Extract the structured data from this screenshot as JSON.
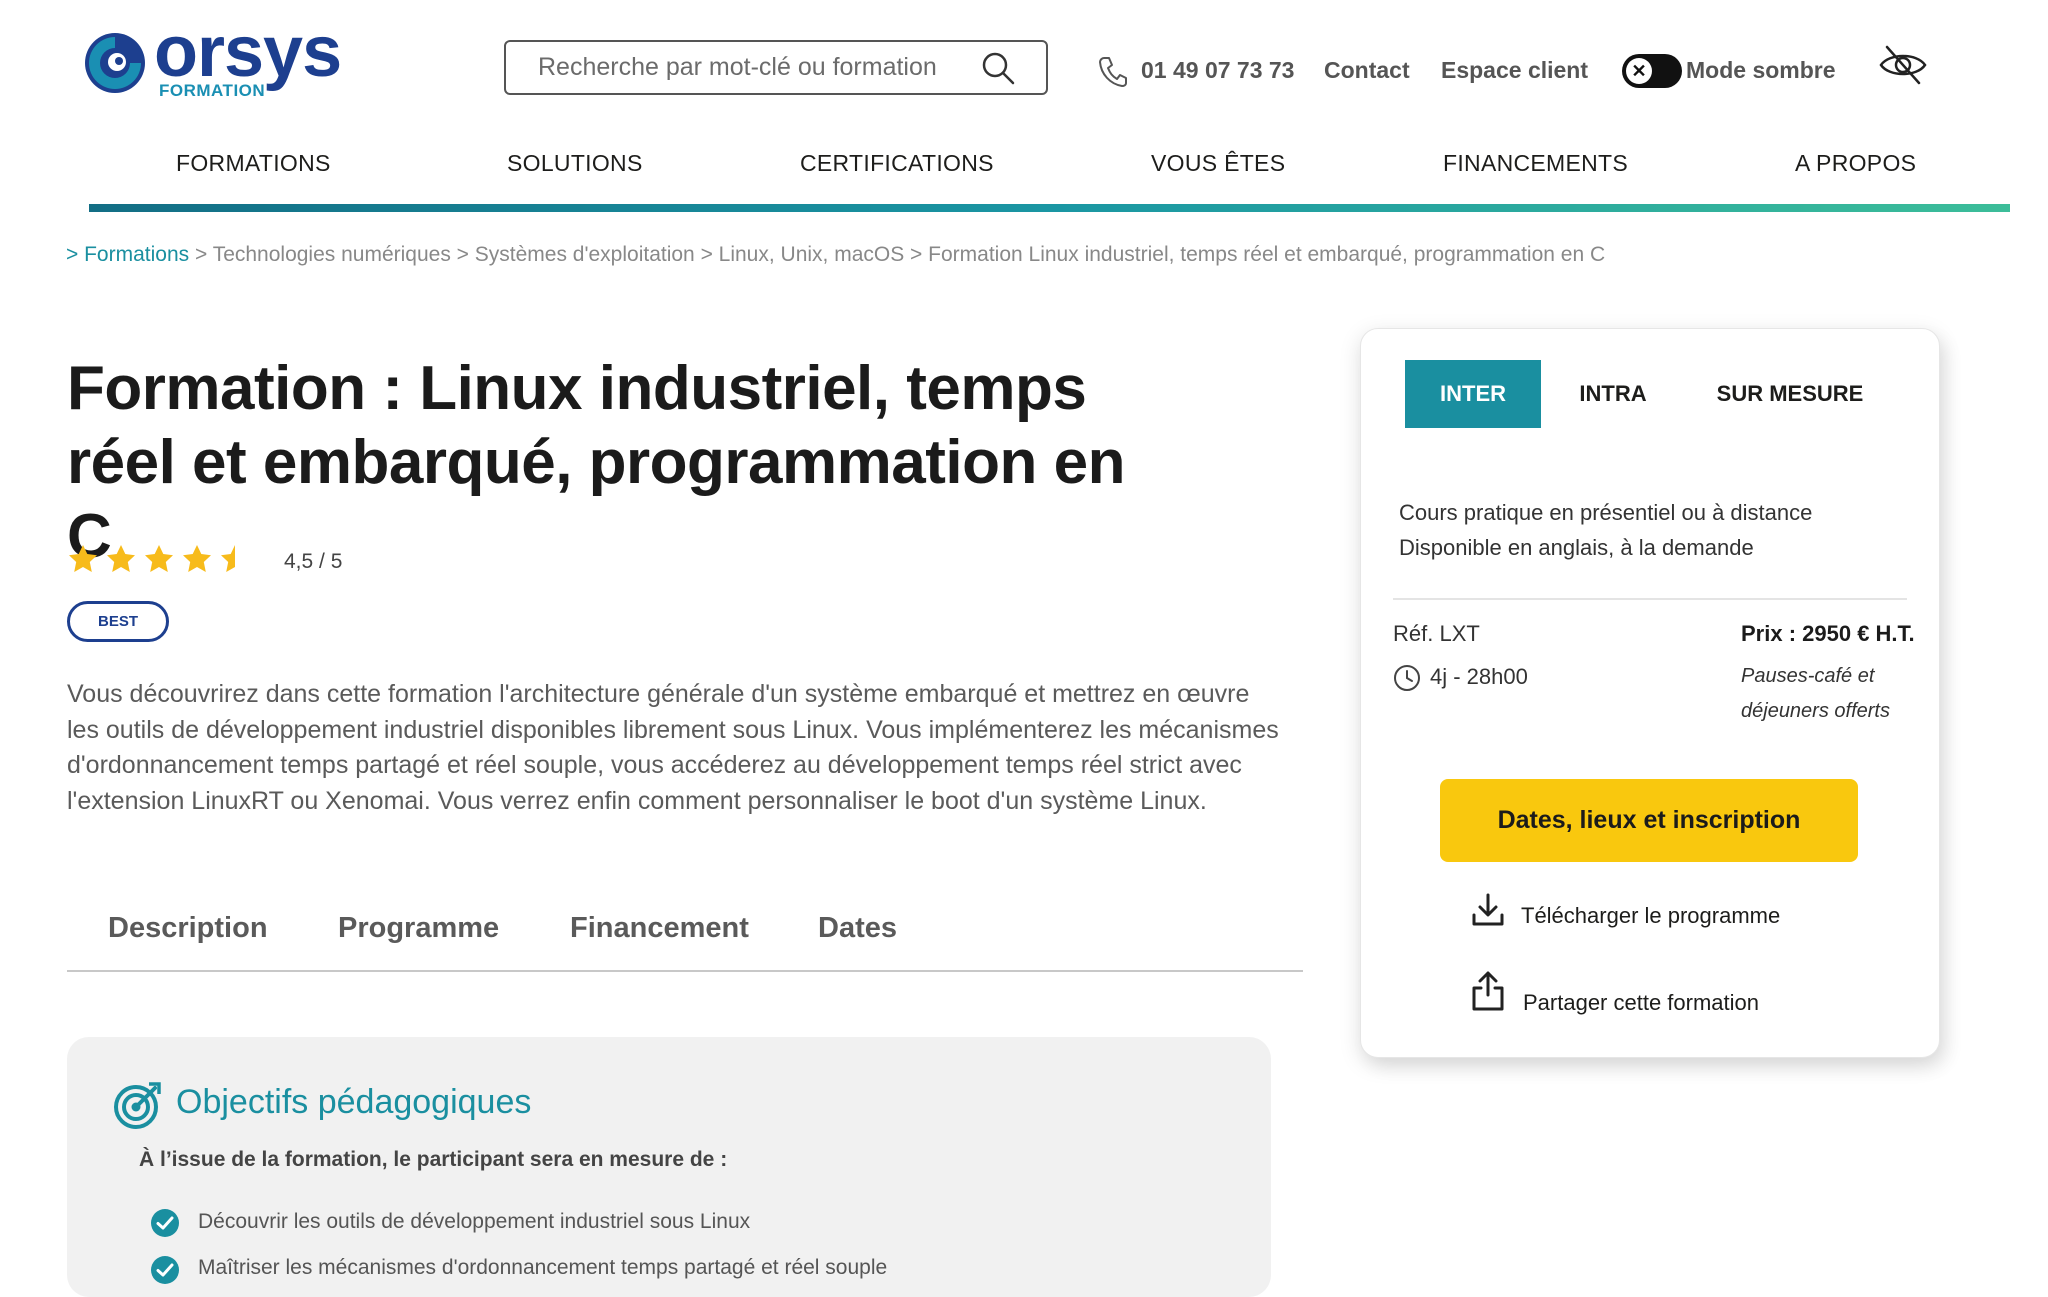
{
  "header": {
    "logo_word": "orsys",
    "logo_sub": "FORMATION",
    "search_placeholder": "Recherche par mot-clé ou formation",
    "phone": "01 49 07 73 73",
    "contact": "Contact",
    "client_space": "Espace client",
    "dark_mode": "Mode sombre",
    "toggle_glyph": "✕",
    "icons": [
      "phone-icon",
      "search-icon",
      "close-icon",
      "eye-off-icon"
    ]
  },
  "nav": {
    "items": [
      "FORMATIONS",
      "SOLUTIONS",
      "CERTIFICATIONS",
      "VOUS ÊTES",
      "FINANCEMENTS",
      "A PROPOS"
    ]
  },
  "breadcrumb": {
    "first": "> Formations",
    "rest": " > Technologies numériques > Systèmes d'exploitation > Linux, Unix, macOS > Formation Linux industriel, temps réel et embarqué, programmation en C"
  },
  "course": {
    "title": "Formation : Linux industriel, temps réel et embarqué, programmation en C",
    "rating_value": 4.5,
    "rating_max": 5,
    "rating_text": "4,5 / 5",
    "badge": "BEST",
    "description": "Vous découvrirez dans cette formation l'architecture générale d'un système embarqué et mettrez en œuvre les outils de développement industriel disponibles librement sous Linux. Vous implémenterez les mécanismes d'ordonnancement temps partagé et réel souple, vous accéderez au développement temps réel strict avec l'extension LinuxRT ou Xenomai. Vous verrez enfin comment personnaliser le boot d'un système Linux."
  },
  "tabs": [
    "Description",
    "Programme",
    "Financement",
    "Dates"
  ],
  "objectives": {
    "title": "Objectifs pédagogiques",
    "intro": "À l’issue de la formation, le participant sera en mesure de :",
    "items": [
      "Découvrir les outils de développement industriel sous Linux",
      "Maîtriser les mécanismes d'ordonnancement temps partagé et réel souple"
    ]
  },
  "card": {
    "tabs": [
      "INTER",
      "INTRA",
      "SUR MESURE"
    ],
    "active_tab": "INTER",
    "info_line1": "Cours pratique en présentiel ou à distance",
    "info_line2": "Disponible en anglais, à la demande",
    "ref": "Réf. LXT",
    "duration": "4j - 28h00",
    "price": "Prix : 2950 € H.T.",
    "price_note_line1": "Pauses-café et",
    "price_note_line2": "déjeuners offerts",
    "cta": "Dates, lieux et inscription",
    "download": "Télécharger le programme",
    "share": "Partager cette formation"
  },
  "colors": {
    "brand_blue": "#1d3f8f",
    "accent_teal": "#1a8fa0",
    "cta_yellow": "#f9c80e",
    "star_yellow": "#f7bb1b"
  }
}
